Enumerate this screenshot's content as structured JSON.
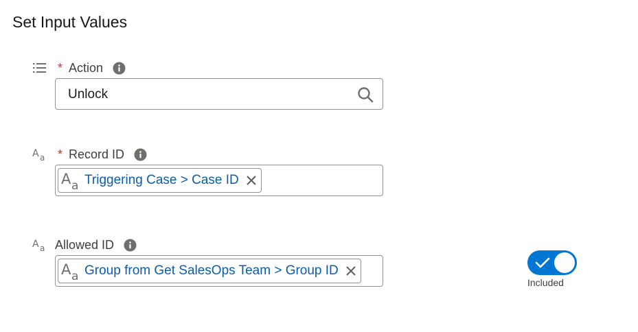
{
  "section": {
    "title": "Set Input Values"
  },
  "fields": {
    "action": {
      "required_mark": "*",
      "label": "Action",
      "value": "Unlock",
      "type_icon": "list-icon",
      "info_icon": "info-icon",
      "search_icon": "search-icon"
    },
    "record_id": {
      "required_mark": "*",
      "label": "Record ID",
      "type_icon": "text-type-icon",
      "info_icon": "info-icon",
      "pill": {
        "text": "Triggering Case > Case ID",
        "icon": "text-type-icon",
        "remove_icon": "close-icon"
      }
    },
    "allowed_id": {
      "label": "Allowed ID",
      "type_icon": "text-type-icon",
      "info_icon": "info-icon",
      "pill": {
        "text": "Group from Get SalesOps Team > Group ID",
        "icon": "text-type-icon",
        "remove_icon": "close-icon"
      },
      "toggle": {
        "state": "on",
        "label": "Included"
      }
    }
  },
  "colors": {
    "accent": "#0176d3",
    "link": "#0b5cab",
    "required": "#c23934",
    "border": "#939393",
    "icon_gray": "#706e6b"
  }
}
